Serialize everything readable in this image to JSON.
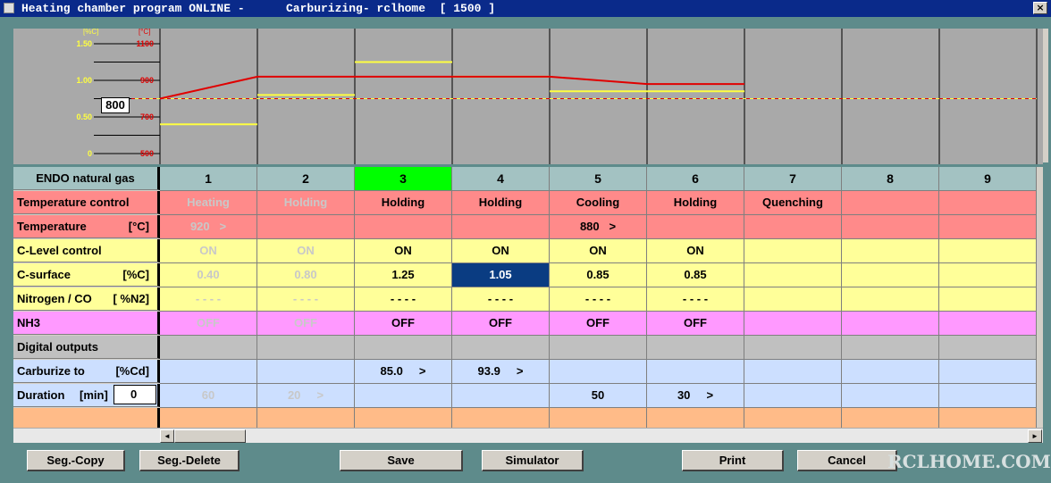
{
  "window": {
    "title_left": "Heating chamber program ONLINE -",
    "title_right": "Carburizing- rclhome  [ 1500 ]",
    "close_glyph": "×"
  },
  "chart": {
    "left_unit": "[%C]",
    "right_unit": "[°C]",
    "left_ticks": [
      "1.50",
      "1.00",
      "0.50",
      "0"
    ],
    "right_ticks": [
      "1100",
      "900",
      "700",
      "500"
    ],
    "setpoint_value": "800",
    "colors": {
      "temp_line": "#e00000",
      "carbon_line": "#ffff40",
      "ref_line": "#e00000",
      "bg": "#a9a9a9"
    },
    "temperature_steps": [
      [
        0,
        800
      ],
      [
        1,
        920
      ],
      [
        2,
        920
      ],
      [
        3,
        920
      ],
      [
        4,
        920
      ],
      [
        5,
        880
      ],
      [
        6,
        880
      ]
    ],
    "carbon_steps": [
      0.4,
      0.8,
      1.25,
      1.05,
      0.85,
      0.85
    ],
    "reference_temperature": 800
  },
  "grid": {
    "header_label": "ENDO natural gas",
    "columns": [
      "1",
      "2",
      "3",
      "4",
      "5",
      "6",
      "7",
      "8",
      "9"
    ],
    "active_column": 3,
    "rows": [
      {
        "id": "temp_control",
        "label": "Temperature control",
        "unit": "",
        "color": "#ff8a8a",
        "cells": [
          "Heating",
          "Holding",
          "Holding",
          "Holding",
          "Cooling",
          "Holding",
          "Quenching",
          "",
          ""
        ]
      },
      {
        "id": "temperature",
        "label": "Temperature",
        "unit": "[°C]",
        "color": "#ff8a8a",
        "cells": [
          "920   >",
          "",
          "",
          "",
          "880   >",
          "",
          "",
          "",
          ""
        ]
      },
      {
        "id": "c_level",
        "label": "C-Level control",
        "unit": "",
        "color": "#ffff99",
        "cells": [
          "ON",
          "ON",
          "ON",
          "ON",
          "ON",
          "ON",
          "",
          "",
          ""
        ]
      },
      {
        "id": "c_surface",
        "label": "C-surface",
        "unit": "[%C]",
        "color": "#ffff99",
        "cells": [
          "0.40",
          "0.80",
          "1.25",
          "1.05",
          "0.85",
          "0.85",
          "",
          "",
          ""
        ]
      },
      {
        "id": "nitrogen",
        "label": "Nitrogen / CO",
        "unit": "[ %N2]",
        "color": "#ffff99",
        "cells": [
          "- - - -",
          "- - - -",
          "- - - -",
          "- - - -",
          "- - - -",
          "- - - -",
          "",
          "",
          ""
        ]
      },
      {
        "id": "nh3",
        "label": "NH3",
        "unit": "",
        "color": "#ff99ff",
        "cells": [
          "OFF",
          "OFF",
          "OFF",
          "OFF",
          "OFF",
          "OFF",
          "",
          "",
          ""
        ]
      },
      {
        "id": "digital",
        "label": "Digital outputs",
        "unit": "",
        "color": "#c0c0c0",
        "cells": [
          "",
          "",
          "",
          "",
          "",
          "",
          "",
          "",
          ""
        ]
      },
      {
        "id": "carburize",
        "label": "Carburize to",
        "unit": "[%Cd]",
        "color": "#ccdfff",
        "cells": [
          "",
          "",
          "85.0     >",
          "93.9     >",
          "",
          "",
          "",
          "",
          ""
        ]
      },
      {
        "id": "duration",
        "label": "Duration",
        "unit": "[min]",
        "input_value": "0",
        "color": "#ccdfff",
        "cells": [
          "60",
          "20     >",
          "",
          "",
          "50",
          "30     >",
          "",
          "",
          ""
        ]
      },
      {
        "id": "extra",
        "label": "",
        "unit": "",
        "color": "#ffbb88",
        "cells": [
          "",
          "",
          "",
          "",
          "",
          "",
          "",
          "",
          ""
        ]
      }
    ],
    "dim_columns": [
      1,
      2
    ],
    "selected_cell": {
      "row": "c_surface",
      "column": 4
    }
  },
  "buttons": {
    "seg_copy": "Seg.-Copy",
    "seg_delete": "Seg.-Delete",
    "save": "Save",
    "simulator": "Simulator",
    "print": "Print",
    "cancel": "Cancel"
  },
  "scroll": {
    "left_glyph": "◄",
    "right_glyph": "►"
  },
  "watermark": "RCLHOME.COM"
}
